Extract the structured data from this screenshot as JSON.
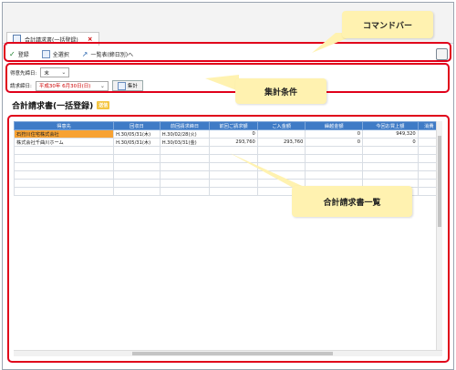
{
  "tab": {
    "title": "合計請求書(一括登録)",
    "close": "×"
  },
  "commands": {
    "register": "登録",
    "select_all": "全選択",
    "to_list": "一覧表(締日別)へ"
  },
  "conditions": {
    "closing_label": "得意先締日:",
    "closing_value": "末",
    "billing_label": "請求締日:",
    "billing_value": "平成30年 6月30日(日)",
    "tally_button": "集計"
  },
  "page_title": "合計請求書(一括登録)",
  "badge": "送信",
  "table": {
    "columns": [
      "得意先",
      "回収日",
      "前回請求締日",
      "前回ご請求額",
      "ご入金額",
      "繰越金額",
      "今回お買上額",
      "消費"
    ],
    "rows": [
      [
        "石狩川住宅株式会社",
        "H.30/05/31(木)",
        "H.30/02/28(火)",
        "0",
        "",
        "0",
        "949,320",
        ""
      ],
      [
        "株式会社千曲川ホーム",
        "H.30/05/31(木)",
        "H.30/03/31(金)",
        "293,760",
        "293,760",
        "0",
        "0",
        ""
      ]
    ]
  },
  "callouts": {
    "command_bar": "コマンドバー",
    "conditions": "集計条件",
    "list": "合計請求書一覧"
  },
  "colors": {
    "highlight": "#e0001a",
    "header": "#3f7bc6",
    "callout": "#fff2b0",
    "selected": "#f7a233"
  }
}
